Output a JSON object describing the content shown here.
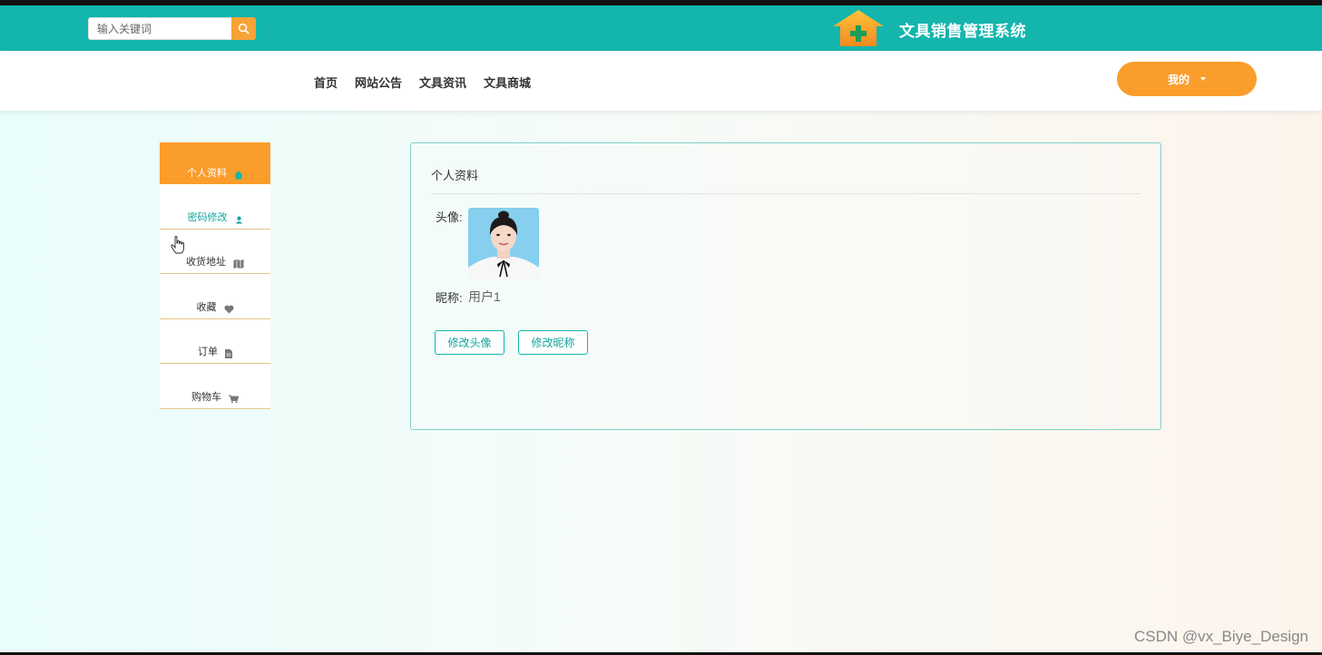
{
  "header": {
    "search_placeholder": "输入关键词",
    "search_icon": "search-icon",
    "logo_icon": "house-plus-icon",
    "system_title": "文具销售管理系统"
  },
  "nav": {
    "items": [
      "首页",
      "网站公告",
      "文具资讯",
      "文具商城"
    ],
    "mine_label": "我的"
  },
  "sidebar": {
    "items": [
      {
        "label": "个人资料",
        "icon": "home-icon"
      },
      {
        "label": "密码修改",
        "icon": "user-icon"
      },
      {
        "label": "收货地址",
        "icon": "map-icon"
      },
      {
        "label": "收藏",
        "icon": "heart-icon"
      },
      {
        "label": "订单",
        "icon": "file-icon"
      },
      {
        "label": "购物车",
        "icon": "cart-icon"
      }
    ]
  },
  "profile": {
    "title": "个人资料",
    "avatar_label": "头像:",
    "nickname_label": "昵称:",
    "nickname_value": "用户1",
    "change_avatar_button": "修改头像",
    "change_nickname_button": "修改昵称"
  },
  "watermark": "CSDN @vx_Biye_Design",
  "colors": {
    "teal": "#13b5ad",
    "orange": "#fb9d2b",
    "sidebar_divider": "#e3c585"
  }
}
